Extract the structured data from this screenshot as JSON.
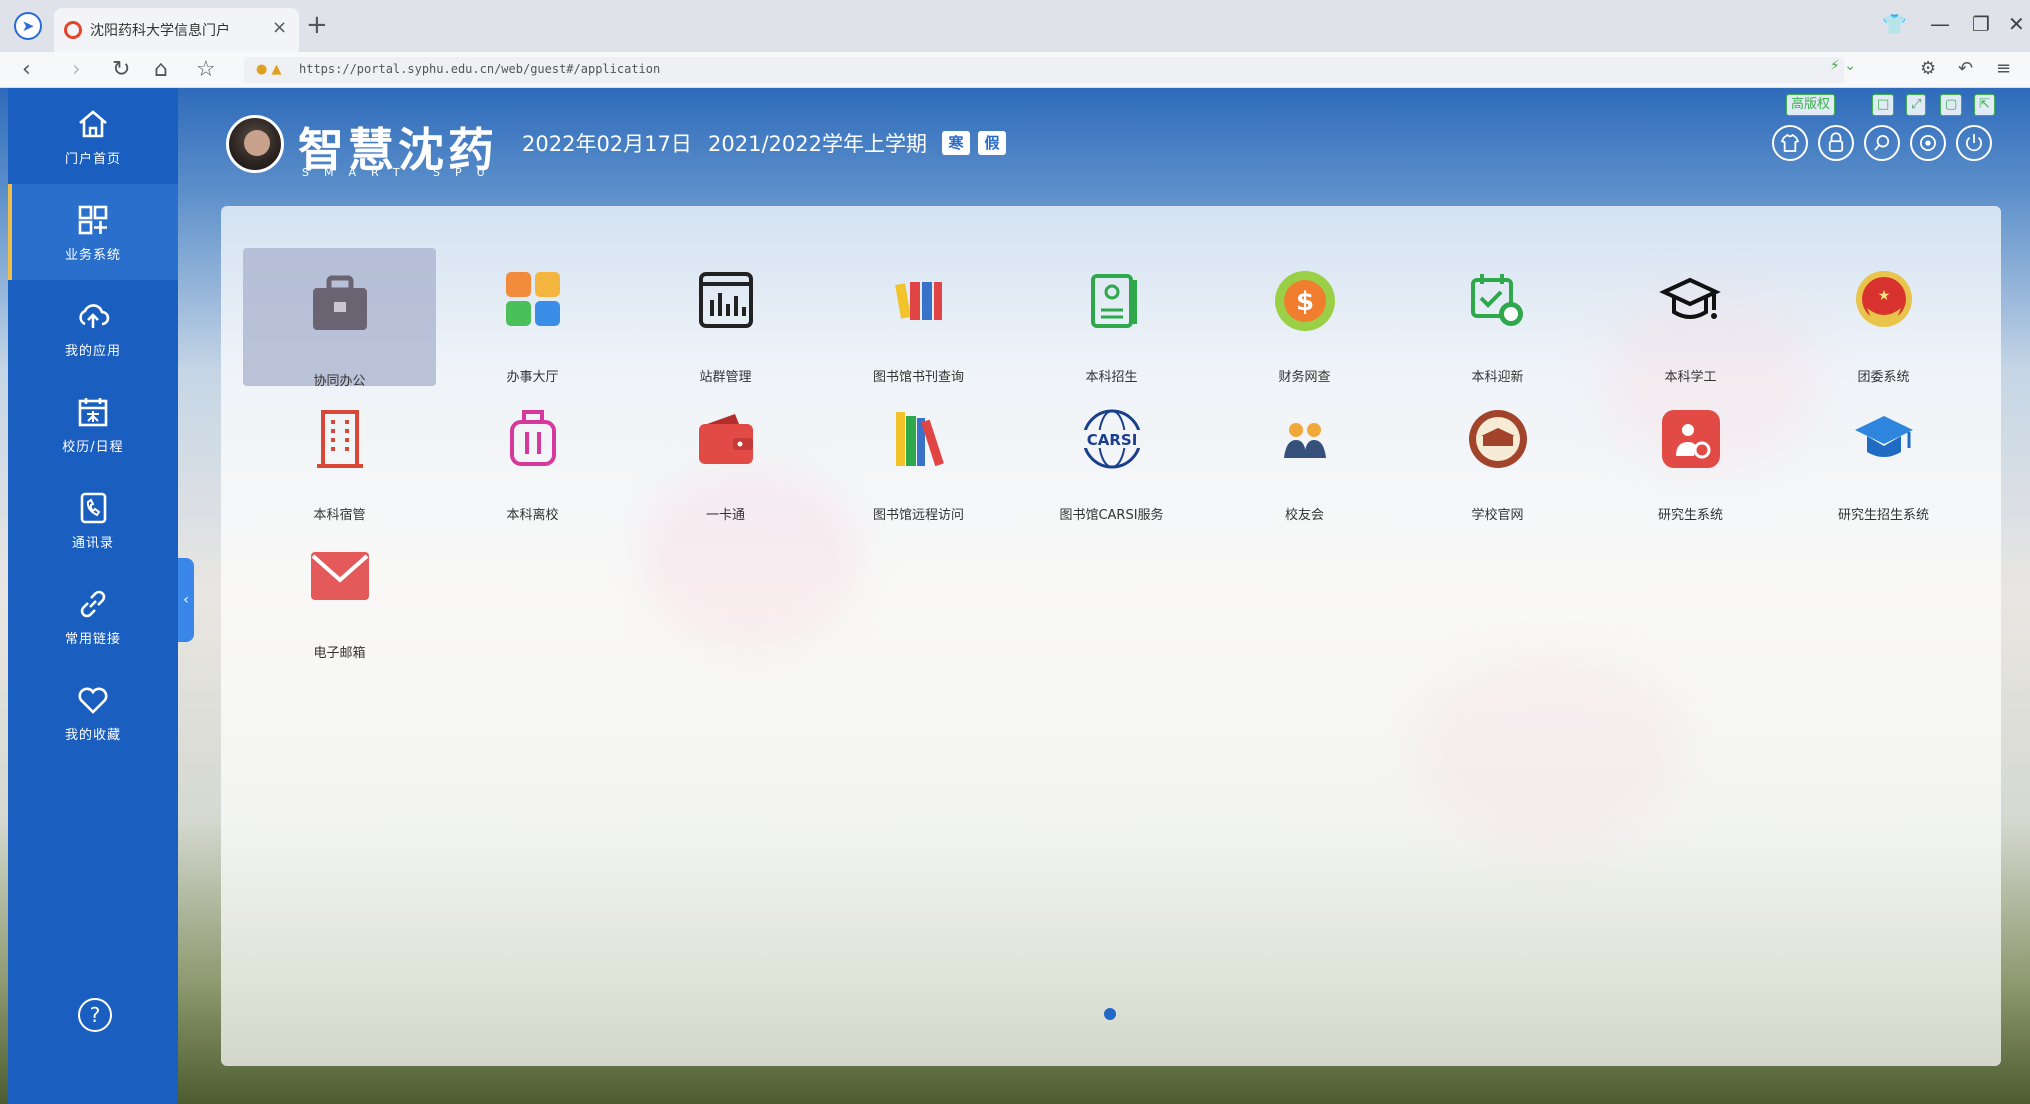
{
  "browser": {
    "tab_title": "沈阳药科大学信息门户",
    "url": "https://portal.syphu.edu.cn/web/guest#/application"
  },
  "header": {
    "brand_title": "智慧沈药",
    "brand_subtitle": "SMART SPU",
    "date": "2022年02月17日",
    "term": "2021/2022学年上学期",
    "badge_1": "寒",
    "badge_2": "假",
    "tools": [
      "高版权",
      "□",
      "⤢",
      "▢",
      "⇱"
    ]
  },
  "sidebar": {
    "items": [
      {
        "label": "门户首页",
        "icon": "home-icon"
      },
      {
        "label": "业务系统",
        "icon": "apps-grid-icon"
      },
      {
        "label": "我的应用",
        "icon": "cloud-upload-icon"
      },
      {
        "label": "校历/日程",
        "icon": "calendar-icon"
      },
      {
        "label": "通讯录",
        "icon": "phone-book-icon"
      },
      {
        "label": "常用链接",
        "icon": "link-icon"
      },
      {
        "label": "我的收藏",
        "icon": "heart-icon"
      }
    ],
    "active_index": 1,
    "help": "?"
  },
  "apps": [
    {
      "label": "协同办公",
      "icon": "briefcase-icon"
    },
    {
      "label": "办事大厅",
      "icon": "four-squares-icon"
    },
    {
      "label": "站群管理",
      "icon": "bar-chart-window-icon"
    },
    {
      "label": "图书馆书刊查询",
      "icon": "book-binders-icon"
    },
    {
      "label": "本科招生",
      "icon": "id-card-icon"
    },
    {
      "label": "财务网查",
      "icon": "dollar-coin-icon"
    },
    {
      "label": "本科迎新",
      "icon": "calendar-new-icon"
    },
    {
      "label": "本科学工",
      "icon": "graduation-cap-icon"
    },
    {
      "label": "团委系统",
      "icon": "youth-league-emblem-icon"
    },
    {
      "label": "本科宿管",
      "icon": "building-icon"
    },
    {
      "label": "本科离校",
      "icon": "luggage-icon"
    },
    {
      "label": "一卡通",
      "icon": "wallet-icon"
    },
    {
      "label": "图书馆远程访问",
      "icon": "books-icon"
    },
    {
      "label": "图书馆CARSI服务",
      "icon": "carsi-globe-icon"
    },
    {
      "label": "校友会",
      "icon": "people-icon"
    },
    {
      "label": "学校官网",
      "icon": "school-seal-icon"
    },
    {
      "label": "研究生系统",
      "icon": "graduate-gear-icon"
    },
    {
      "label": "研究生招生系统",
      "icon": "blue-cap-icon"
    },
    {
      "label": "电子邮箱",
      "icon": "envelope-icon"
    }
  ],
  "carsi_text": "CARSI",
  "selected_app_index": 0
}
